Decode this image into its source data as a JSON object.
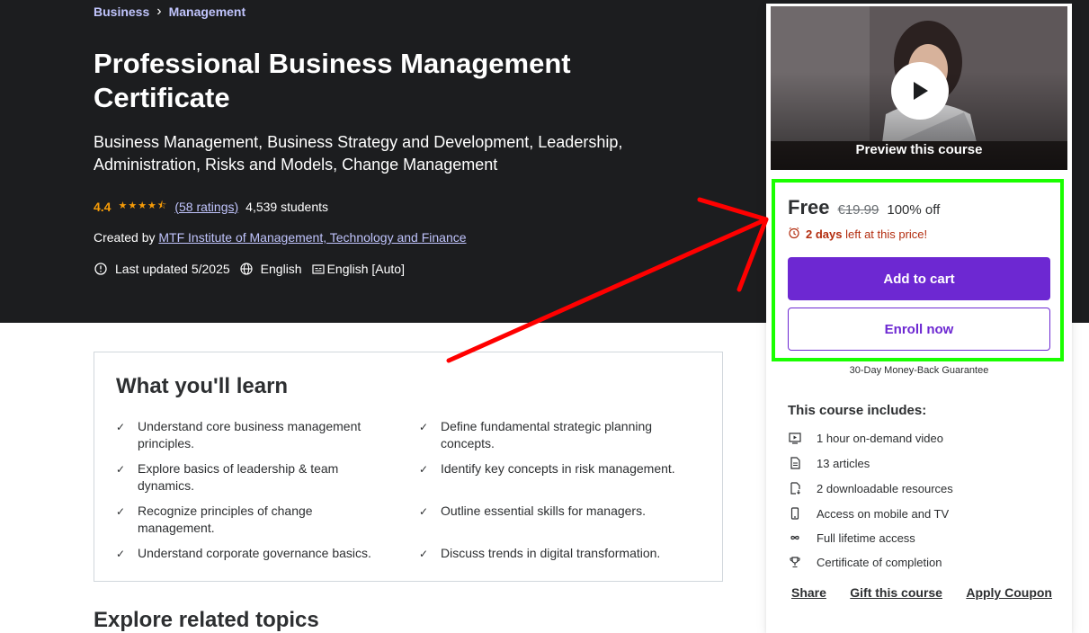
{
  "breadcrumb": {
    "items": [
      "Business",
      "Management"
    ],
    "separator": "›"
  },
  "course": {
    "title": "Professional Business Management Certificate",
    "subtitle": "Business Management, Business Strategy and Development, Leadership, Administration, Risks and Models, Change Management",
    "rating": "4.4",
    "stars": "★★★★⯪",
    "ratings_count": "(58 ratings)",
    "students": "4,539 students",
    "created_by_label": "Created by",
    "instructor": "MTF Institute of Management, Technology and Finance",
    "last_updated": "Last updated 5/2025",
    "language": "English",
    "captions": "English [Auto]"
  },
  "learn": {
    "title": "What you'll learn",
    "items": [
      "Understand core business management principles.",
      "Define fundamental strategic planning concepts.",
      "Explore basics of leadership & team dynamics.",
      "Identify key concepts in risk management.",
      "Recognize principles of change management.",
      "Outline essential skills for managers.",
      "Understand corporate governance basics.",
      "Discuss trends in digital transformation."
    ]
  },
  "next_section": {
    "title": "Explore related topics"
  },
  "sidebar": {
    "preview_label": "Preview this course",
    "price": "Free",
    "original_price": "€19.99",
    "discount": "100% off",
    "timer_bold": "2 days",
    "timer_rest": "left at this price!",
    "add_to_cart": "Add to cart",
    "enroll": "Enroll now",
    "guarantee": "30-Day Money-Back Guarantee",
    "includes_title": "This course includes:",
    "includes": [
      {
        "icon": "video-icon",
        "label": "1 hour on-demand video"
      },
      {
        "icon": "article-icon",
        "label": "13 articles"
      },
      {
        "icon": "download-file-icon",
        "label": "2 downloadable resources"
      },
      {
        "icon": "mobile-icon",
        "label": "Access on mobile and TV"
      },
      {
        "icon": "infinity-icon",
        "label": "Full lifetime access"
      },
      {
        "icon": "trophy-icon",
        "label": "Certificate of completion"
      }
    ],
    "links": [
      "Share",
      "Gift this course",
      "Apply Coupon"
    ]
  },
  "colors": {
    "hero_bg": "#1c1d1f",
    "accent_purple": "#6d28d2",
    "star_orange": "#f69c08",
    "link_light": "#c0c4fc",
    "timer_red": "#b32d0f",
    "annotation_green": "#1aff00",
    "annotation_red": "#ff0000"
  }
}
